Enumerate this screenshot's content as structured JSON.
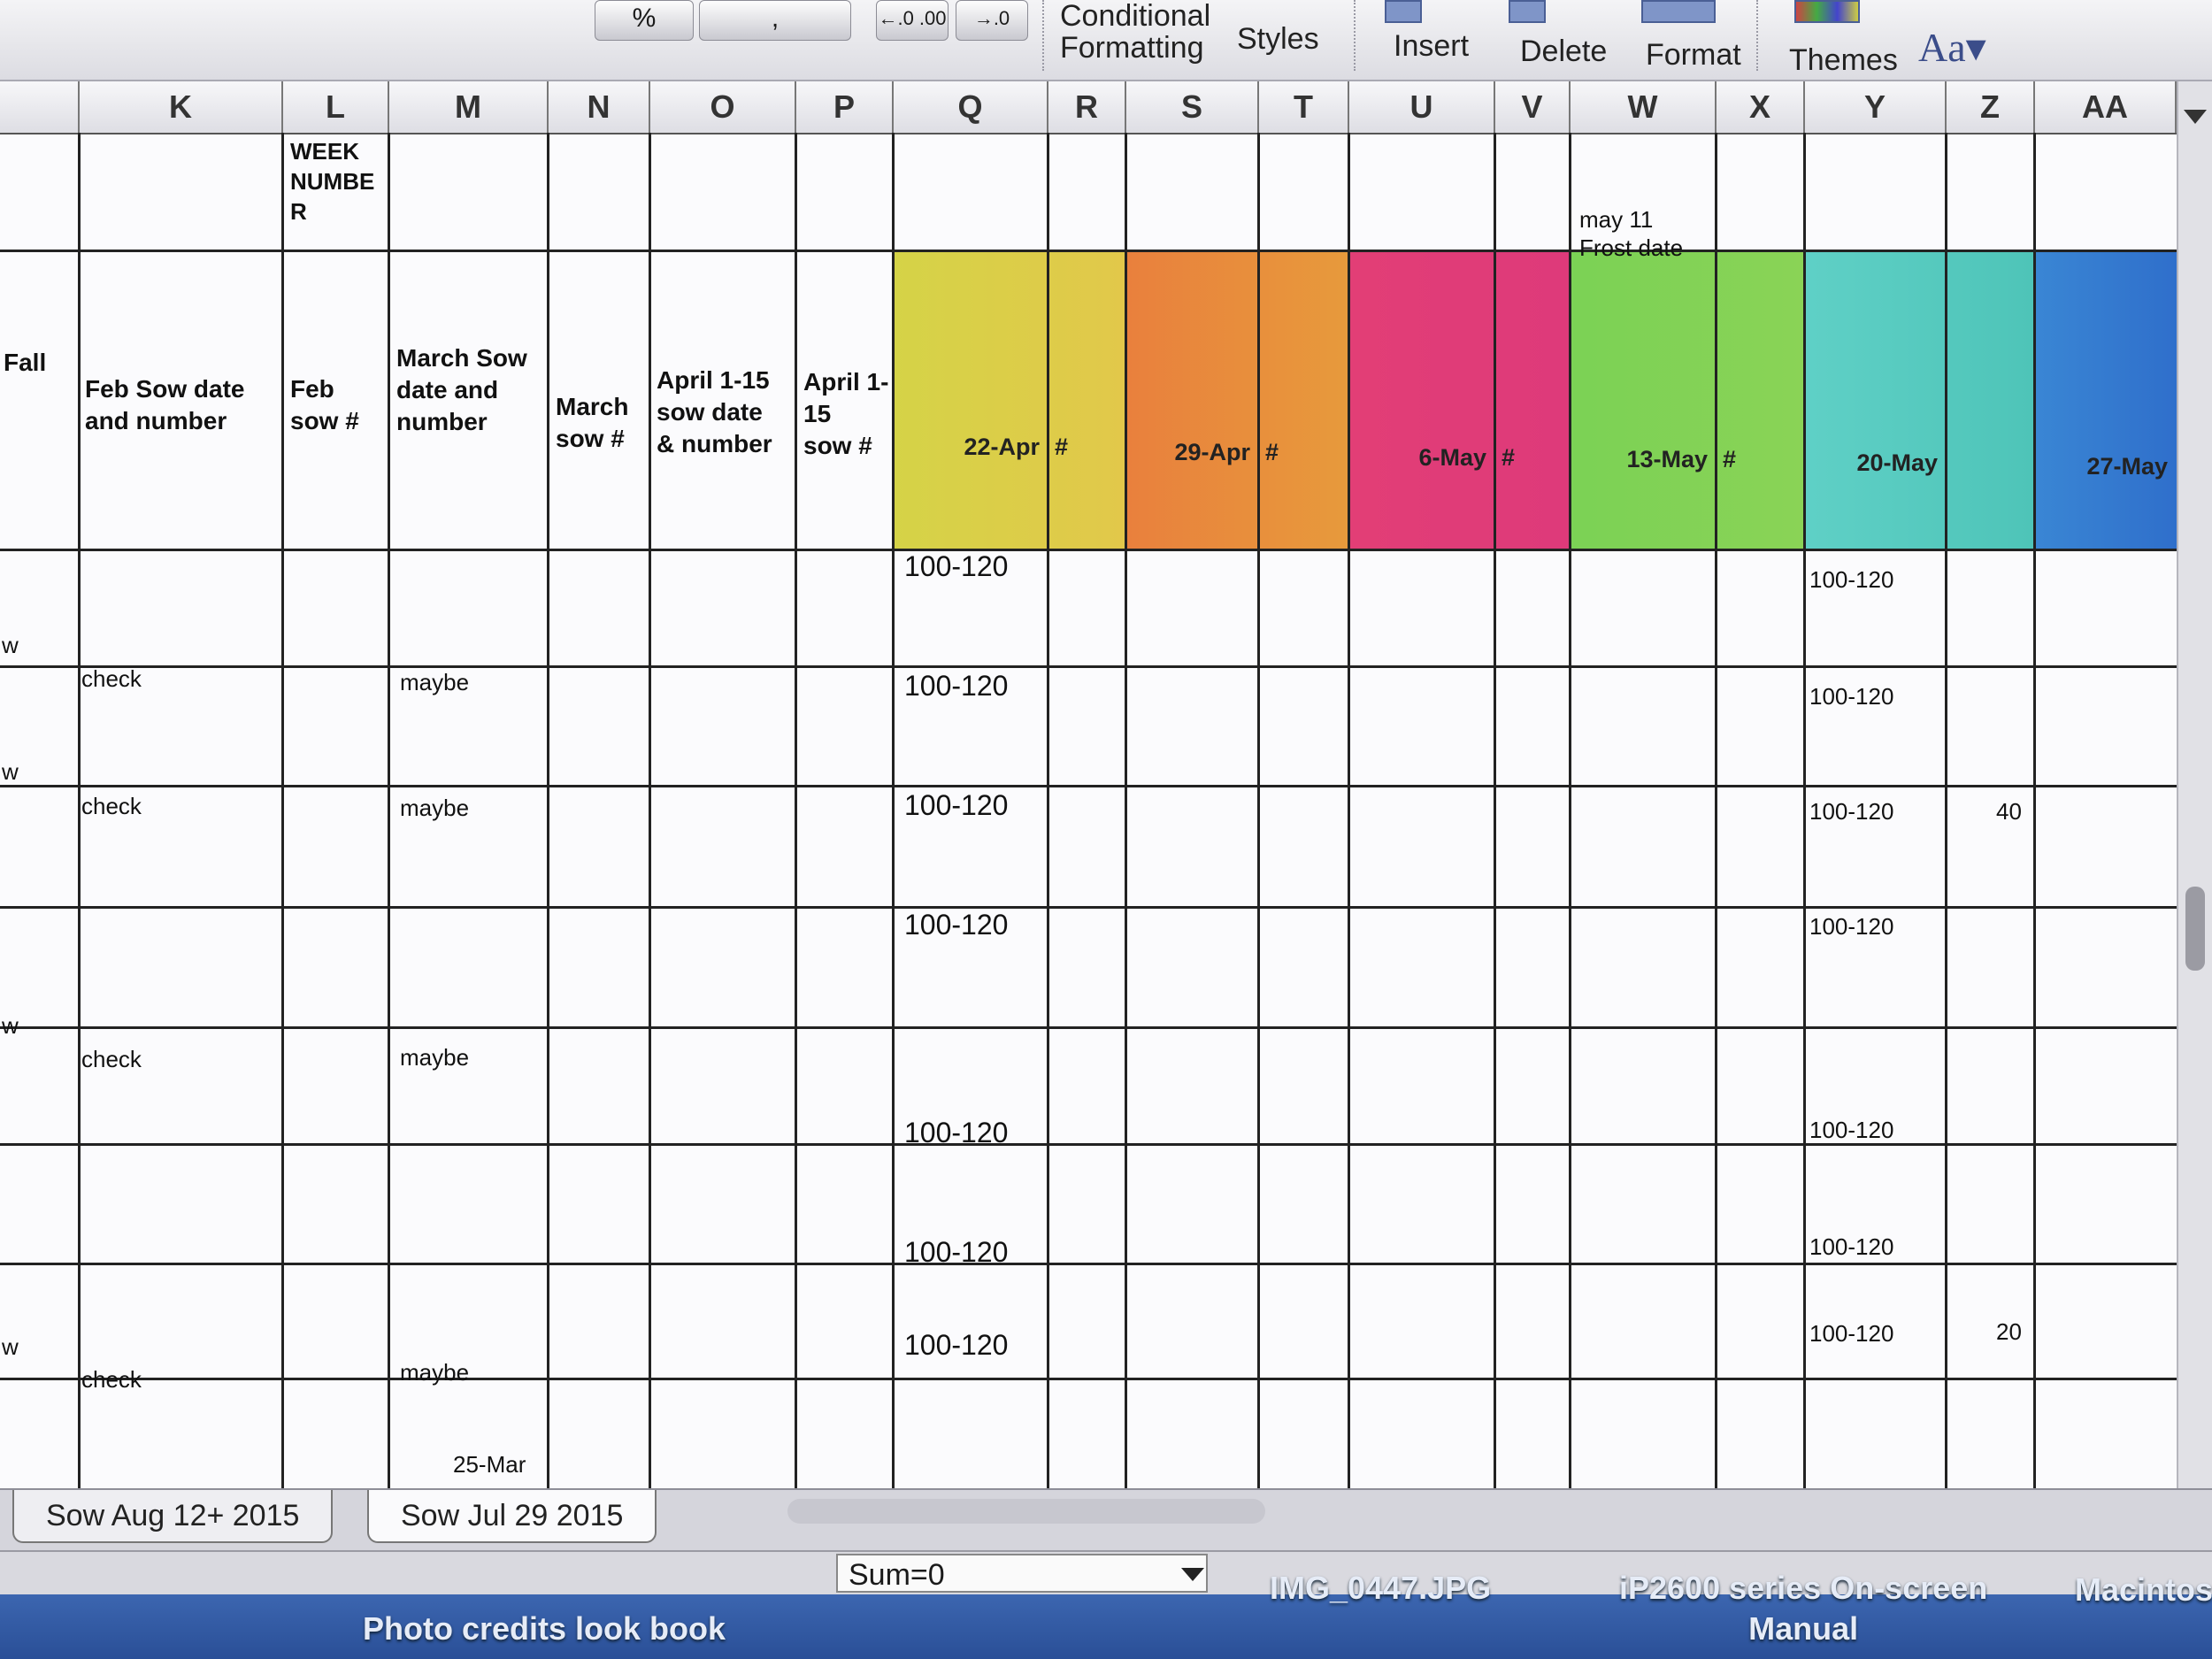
{
  "ribbon": {
    "number_format_value": "%",
    "comma_label": ",",
    "increase_decimal": "←.0 .00",
    "decrease_decimal": "→.0",
    "conditional_formatting": [
      "Conditional",
      "Formatting"
    ],
    "styles": "Styles",
    "insert": "Insert",
    "delete": "Delete",
    "format": "Format",
    "themes": "Themes",
    "font_size_button": "Aa▾"
  },
  "columns": [
    "K",
    "L",
    "M",
    "N",
    "O",
    "P",
    "Q",
    "R",
    "S",
    "T",
    "U",
    "V",
    "W",
    "X",
    "Y",
    "Z",
    "AA"
  ],
  "header_row": {
    "l_note": [
      "WEEK",
      "NUMBE",
      "R"
    ],
    "w_note": [
      "may 11",
      "Frost date"
    ]
  },
  "headers": {
    "fall": "Fall",
    "k": [
      "Feb Sow date",
      "and number"
    ],
    "l": [
      "Feb",
      "sow #"
    ],
    "m": [
      "March Sow",
      "date and",
      "number"
    ],
    "n": [
      "March",
      "sow #"
    ],
    "o": [
      "April 1-15",
      "sow date",
      "& number"
    ],
    "p": [
      "April 1-",
      "15",
      "sow #"
    ]
  },
  "week_headers": [
    {
      "date": "22-Apr",
      "hash": "#",
      "color": "#d9d64a"
    },
    {
      "date": "29-Apr",
      "hash": "#",
      "color": "#e8843a"
    },
    {
      "date": "6-May",
      "hash": "#",
      "color": "#e03c78"
    },
    {
      "date": "13-May",
      "hash": "#",
      "color": "#79cf55"
    },
    {
      "date": "20-May",
      "hash": "",
      "color": "#5ccdc0"
    },
    {
      "date": "27-May",
      "hash": "",
      "color": "#3f7fd6"
    }
  ],
  "rows": [
    {
      "k": "",
      "m": "",
      "q": "100-120",
      "y": "100-120",
      "z": "",
      "edge": ""
    },
    {
      "k": "check",
      "m": "maybe",
      "q": "100-120",
      "y": "100-120",
      "z": "",
      "edge": "w"
    },
    {
      "k": "check",
      "m": "maybe",
      "q": "100-120",
      "y": "100-120",
      "z": "40",
      "edge": "w"
    },
    {
      "k": "",
      "m": "",
      "q": "100-120",
      "y": "100-120",
      "z": "",
      "edge": ""
    },
    {
      "k": "check",
      "m": "maybe",
      "q": "",
      "y": "",
      "z": "",
      "edge": "w"
    },
    {
      "k": "",
      "m": "",
      "q": "100-120",
      "y": "100-120",
      "z": "",
      "edge": ""
    },
    {
      "k": "",
      "m": "",
      "q": "100-120",
      "y": "100-120",
      "z": "",
      "edge": ""
    },
    {
      "k": "check",
      "m": "maybe",
      "q": "100-120",
      "y": "100-120",
      "z": "20",
      "edge": "w"
    },
    {
      "k": "",
      "m": "25-Mar",
      "q": "",
      "y": "",
      "z": "",
      "edge": ""
    }
  ],
  "sheet_tabs": [
    "Sow Aug 12+ 2015",
    "Sow Jul 29 2015"
  ],
  "status": {
    "sum": "Sum=0"
  },
  "desktop": {
    "file_label": "Photo credits look book",
    "image_label": "IMG_0447.JPG",
    "manual_label": [
      "iP2600 series On-screen",
      "Manual"
    ],
    "drive_label": "Macintos"
  }
}
